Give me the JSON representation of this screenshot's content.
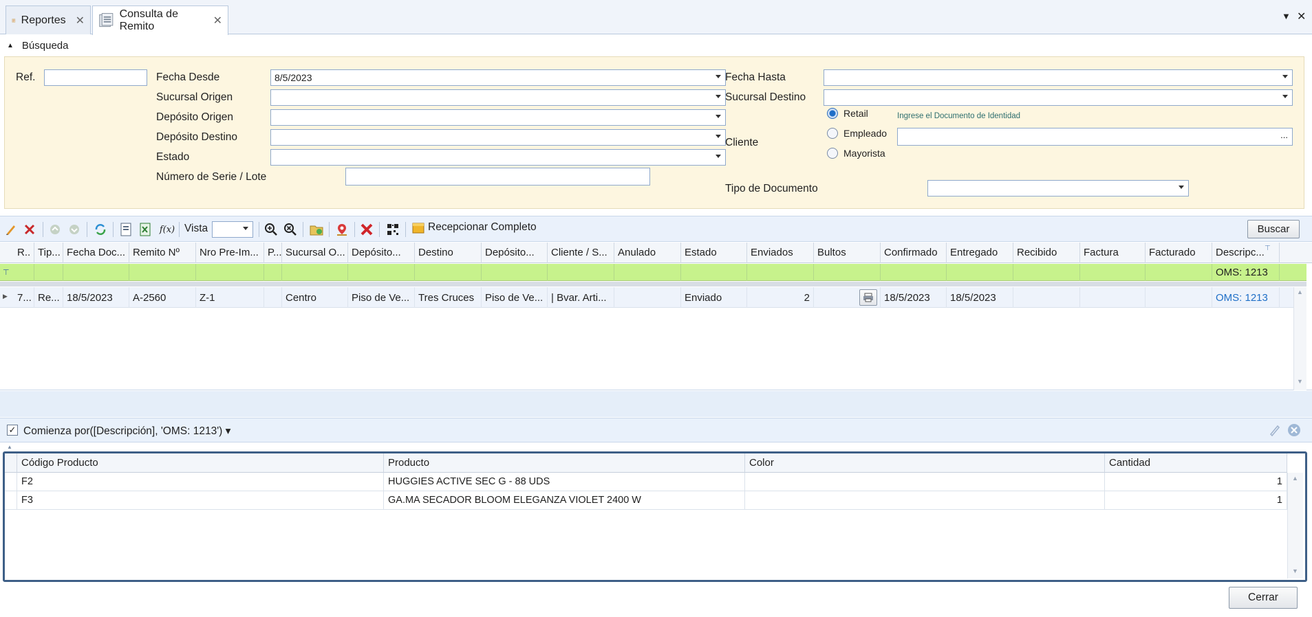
{
  "tabs": [
    {
      "label": "Reportes",
      "icon": "report-icon"
    },
    {
      "label": "Consulta de Remito",
      "icon": "documents-icon"
    }
  ],
  "search_group_label": "Búsqueda",
  "search": {
    "ref_label": "Ref.",
    "ref_value": "",
    "fecha_desde_label": "Fecha Desde",
    "fecha_desde_value": "8/5/2023",
    "sucursal_origen_label": "Sucursal Origen",
    "deposito_origen_label": "Depósito Origen",
    "deposito_destino_label": "Depósito Destino",
    "estado_label": "Estado",
    "numero_serie_label": "Número de Serie / Lote",
    "fecha_hasta_label": "Fecha Hasta",
    "sucursal_destino_label": "Sucursal Destino",
    "cliente_label": "Cliente",
    "cliente_hint": "Ingrese el Documento de Identidad",
    "cliente_types": [
      "Retail",
      "Empleado",
      "Mayorista"
    ],
    "cliente_type_selected": "Retail",
    "cliente_button": "...",
    "tipo_documento_label": "Tipo de Documento"
  },
  "toolbar": {
    "vista_label": "Vista",
    "recepcionar_label": "Recepcionar Completo",
    "buscar_label": "Buscar"
  },
  "grid": {
    "columns": [
      "R..",
      "Tip...",
      "Fecha Doc...",
      "Remito Nº",
      "Nro Pre-Im...",
      "P...",
      "Sucursal O...",
      "Depósito...",
      "Destino",
      "Depósito...",
      "Cliente / S...",
      "Anulado",
      "Estado",
      "Enviados",
      "Bultos",
      "Confirmado",
      "Entregado",
      "Recibido",
      "Factura",
      "Facturado",
      "Descripc..."
    ],
    "filter_value": "OMS: 1213",
    "rows": [
      {
        "r": "7...",
        "tipo": "Re...",
        "fecha": "18/5/2023",
        "remito": "A-2560",
        "nro_pre": "Z-1",
        "p": "",
        "sucursal_origen": "Centro",
        "deposito_origen": "Piso de Ve...",
        "destino": "Tres Cruces",
        "deposito_destino": "Piso de Ve...",
        "cliente": "| Bvar. Arti...",
        "anulado": "",
        "estado": "Enviado",
        "enviados": "2",
        "bultos": "",
        "confirmado": "18/5/2023",
        "entregado": "18/5/2023",
        "recibido": "",
        "factura": "",
        "facturado": "",
        "descripcion": "OMS: 1213"
      }
    ]
  },
  "filter_bar": {
    "text": "Comienza por([Descripción], 'OMS: 1213') ▾",
    "checked": true
  },
  "detail": {
    "columns": [
      "Código Producto",
      "Producto",
      "Color",
      "Cantidad"
    ],
    "rows": [
      {
        "codigo": "F2",
        "producto": "HUGGIES ACTIVE SEC G - 88 UDS",
        "color": "",
        "cantidad": "1"
      },
      {
        "codigo": "F3",
        "producto": "GA.MA SECADOR BLOOM ELEGANZA VIOLET 2400 W",
        "color": "",
        "cantidad": "1"
      }
    ]
  },
  "footer": {
    "cerrar_label": "Cerrar"
  },
  "colors": {
    "accent": "#1f6fc7",
    "filter_row": "#c7f28c",
    "search_panel": "#fdf6e0"
  }
}
